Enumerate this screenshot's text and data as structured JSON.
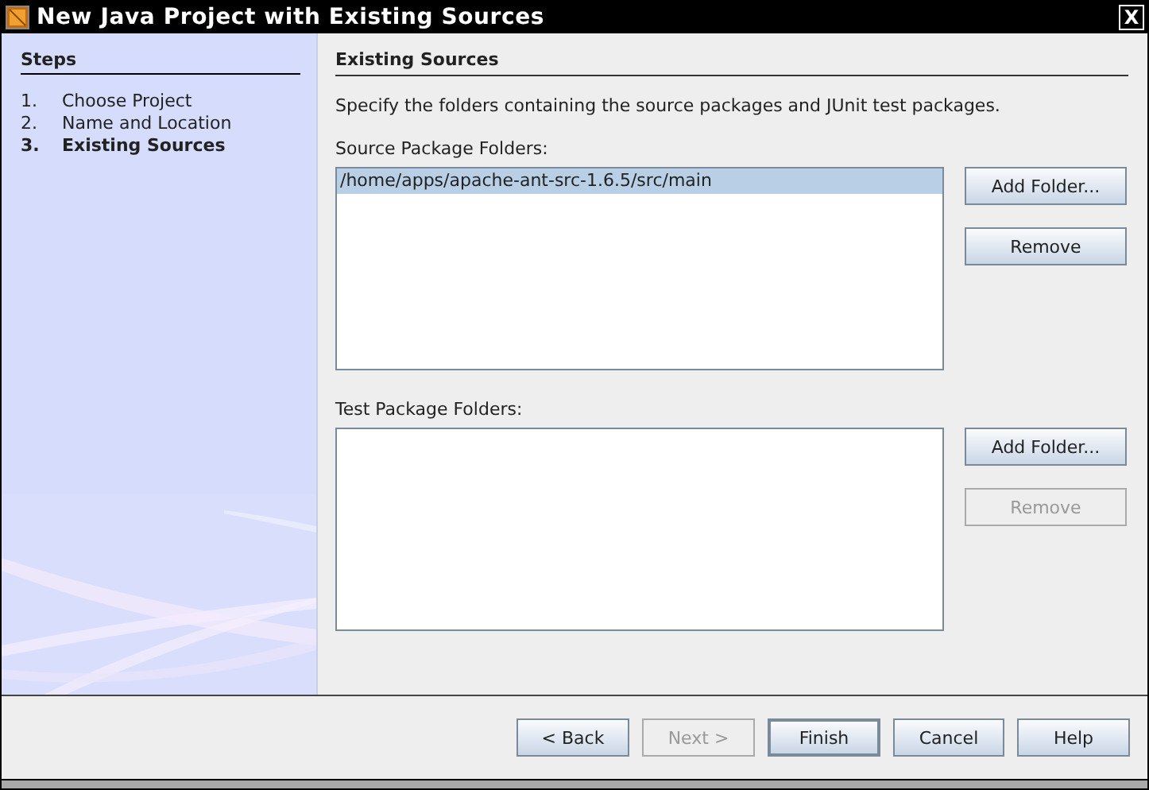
{
  "window": {
    "title": "New Java Project with Existing Sources",
    "close": "X"
  },
  "steps": {
    "heading": "Steps",
    "items": [
      {
        "number": "1.",
        "label": "Choose Project",
        "selected": false
      },
      {
        "number": "2.",
        "label": "Name and Location",
        "selected": false
      },
      {
        "number": "3.",
        "label": "Existing Sources",
        "selected": true
      }
    ]
  },
  "panel": {
    "heading": "Existing Sources",
    "description": "Specify the folders containing the source packages and JUnit test packages.",
    "groups": [
      {
        "label": "Source Package Folders:",
        "items": [
          {
            "text": "/home/apps/apache-ant-src-1.6.5/src/main",
            "selected": true
          }
        ],
        "buttons": [
          {
            "label": "Add Folder...",
            "disabled": false
          },
          {
            "label": "Remove",
            "disabled": false
          }
        ]
      },
      {
        "label": "Test Package Folders:",
        "buttons": [
          {
            "label": "Add Folder...",
            "disabled": false
          },
          {
            "label": "Remove",
            "disabled": true
          }
        ]
      }
    ]
  },
  "buttons": [
    {
      "label": "< Back",
      "disabled": false,
      "default": false
    },
    {
      "label": "Next >",
      "disabled": true,
      "default": false
    },
    {
      "label": "Finish",
      "disabled": false,
      "default": true
    },
    {
      "label": "Cancel",
      "disabled": false,
      "default": false
    },
    {
      "label": "Help",
      "disabled": false,
      "default": false
    }
  ]
}
